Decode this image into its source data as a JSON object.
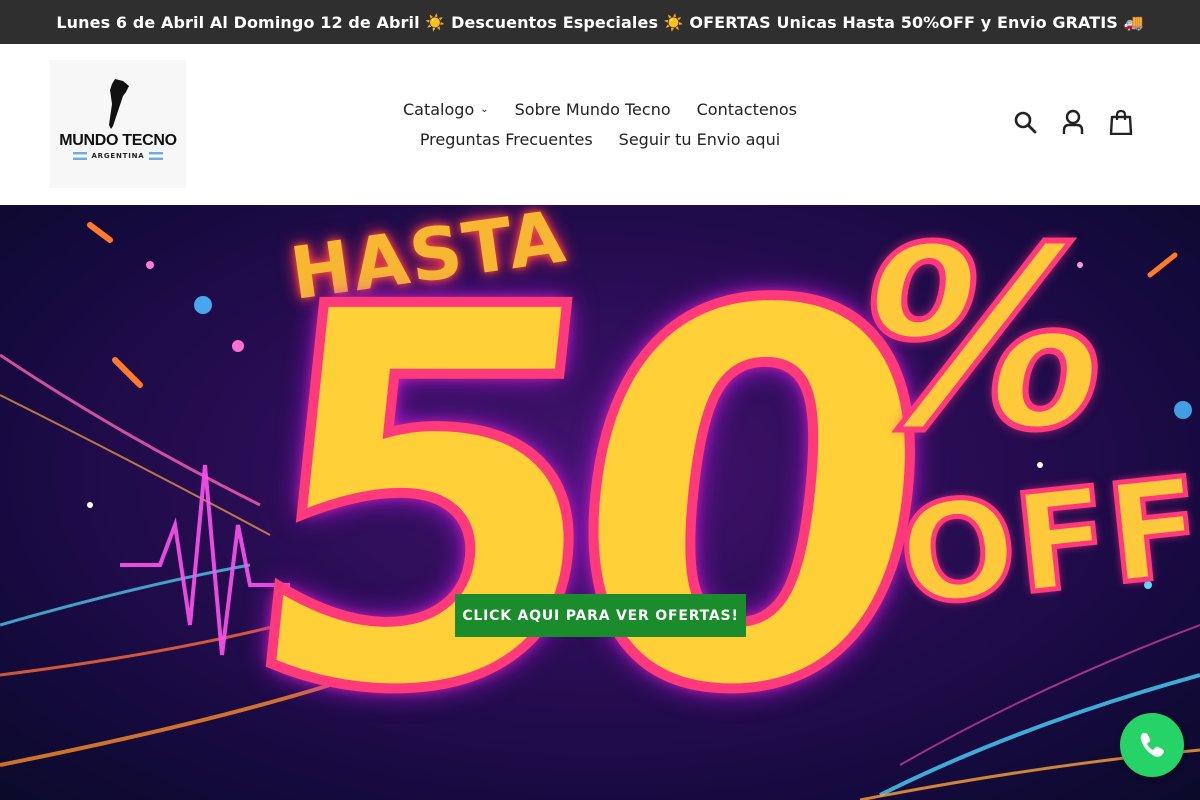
{
  "announcement": {
    "text": "Lunes 6 de Abril Al Domingo 12 de Abril ☀️ Descuentos Especiales ☀️ OFERTAS Unicas Hasta 50%OFF y Envio GRATIS 🚚"
  },
  "logo": {
    "title": "MUNDO TECNO",
    "subtitle": "ARGENTINA"
  },
  "nav": {
    "items": [
      {
        "label": "Catalogo",
        "has_dropdown": true
      },
      {
        "label": "Sobre Mundo Tecno"
      },
      {
        "label": "Contactenos"
      },
      {
        "label": "Preguntas Frecuentes"
      },
      {
        "label": "Seguir tu Envio aqui"
      }
    ]
  },
  "header_icons": [
    "search-icon",
    "account-icon",
    "cart-icon"
  ],
  "hero": {
    "hasta": "HASTA",
    "fifty": "50",
    "percent": "%",
    "off": "OFF",
    "cta_label": "CLICK AQUI PARA VER OFERTAS!"
  },
  "colors": {
    "announcement_bg": "#2f2f2f",
    "cta_bg": "#1a8c2c",
    "whatsapp": "#25d366",
    "hero_yellow": "#ffd037",
    "hero_pink": "#ff3a7a"
  },
  "floating": {
    "icon": "whatsapp-icon"
  }
}
